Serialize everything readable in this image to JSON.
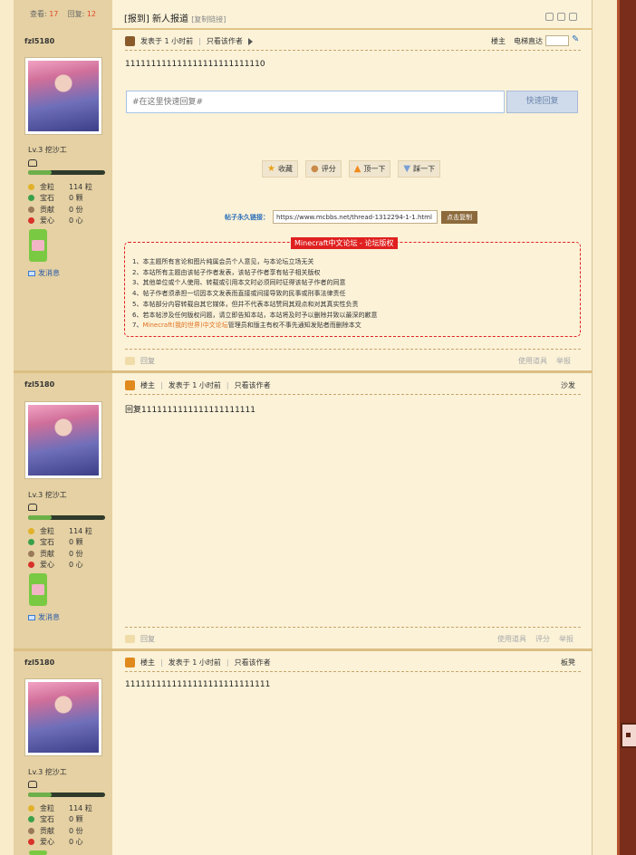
{
  "header": {
    "views_label": "查看:",
    "views": "17",
    "replies_label": "回复:",
    "replies": "12",
    "tag": "[报到]",
    "title": "新人报道",
    "copy_link": "[复制链接]"
  },
  "posts": [
    {
      "username": "fzl5180",
      "rank": "Lv.3 挖沙工",
      "stats": [
        {
          "label": "金粒",
          "value": "114 粒",
          "color": "#e1b12a"
        },
        {
          "label": "宝石",
          "value": "0 颗",
          "color": "#3aa04a"
        },
        {
          "label": "贡献",
          "value": "0 份",
          "color": "#9a7a5a"
        },
        {
          "label": "爱心",
          "value": "0 心",
          "color": "#d8322a"
        }
      ],
      "send_msg": "发消息",
      "meta_posted": "发表于 1 小时前",
      "meta_only": "只看该作者",
      "meta_right_1": "楼主",
      "meta_right_2": "电梯直达",
      "content": "111111111111111111111111110",
      "footer_reply": "回复",
      "footer_right": [
        "使用道具",
        "举报"
      ]
    },
    {
      "username": "fzl5180",
      "rank": "Lv.3 挖沙工",
      "stats": [
        {
          "label": "金粒",
          "value": "114 粒",
          "color": "#e1b12a"
        },
        {
          "label": "宝石",
          "value": "0 颗",
          "color": "#3aa04a"
        },
        {
          "label": "贡献",
          "value": "0 份",
          "color": "#9a7a5a"
        },
        {
          "label": "爱心",
          "value": "0 心",
          "color": "#d8322a"
        }
      ],
      "send_msg": "发消息",
      "meta_author": "楼主",
      "meta_posted": "发表于 1 小时前",
      "meta_only": "只看该作者",
      "floor": "沙发",
      "content": "回复1111111111111111111111",
      "footer_reply": "回复",
      "footer_right": [
        "使用道具",
        "评分",
        "举报"
      ]
    },
    {
      "username": "fzl5180",
      "rank": "Lv.3 挖沙工",
      "stats": [
        {
          "label": "金粒",
          "value": "114 粒",
          "color": "#e1b12a"
        },
        {
          "label": "宝石",
          "value": "0 颗",
          "color": "#3aa04a"
        },
        {
          "label": "贡献",
          "value": "0 份",
          "color": "#9a7a5a"
        },
        {
          "label": "爱心",
          "value": "0 心",
          "color": "#d8322a"
        }
      ],
      "meta_author": "楼主",
      "meta_posted": "发表于 1 小时前",
      "meta_only": "只看该作者",
      "floor": "板凳",
      "content": "1111111111111111111111111111"
    }
  ],
  "quick_reply": {
    "placeholder": "#在这里快速回复#",
    "button": "快速回复"
  },
  "actions": [
    {
      "label": "收藏",
      "icon": "star-icon"
    },
    {
      "label": "评分",
      "icon": "thumb-icon"
    },
    {
      "label": "顶一下",
      "icon": "arrow-up-icon"
    },
    {
      "label": "踩一下",
      "icon": "arrow-down-icon"
    }
  ],
  "permalink": {
    "label": "帖子永久链接：",
    "url": "https://www.mcbbs.net/thread-1312294-1-1.html",
    "button": "点击复制"
  },
  "notice": {
    "title": "Minecraft中文论坛 - 论坛版权",
    "items": [
      "1、本主题所有言论和图片纯属会员个人意见，与本论坛立场无关",
      "2、本站所有主题由该帖子作者发表，该帖子作者享有帖子相关版权",
      "3、其他单位或个人使用、转载或引用本文时必须同时征得该帖子作者的同意",
      "4、帖子作者须承担一切因本文发表而直接或间接导致的民事或刑事法律责任",
      "5、本帖部分内容转载自其它媒体，但并不代表本站赞同其观点和对其真实性负责",
      "6、若本帖涉及任何版权问题，请立即告知本站，本站将及时予以删除并致以最深的歉意",
      "7、",
      "Minecraft(我的世界)中文论坛",
      "管理员和版主有权不事先通知发贴者而删除本文"
    ]
  }
}
